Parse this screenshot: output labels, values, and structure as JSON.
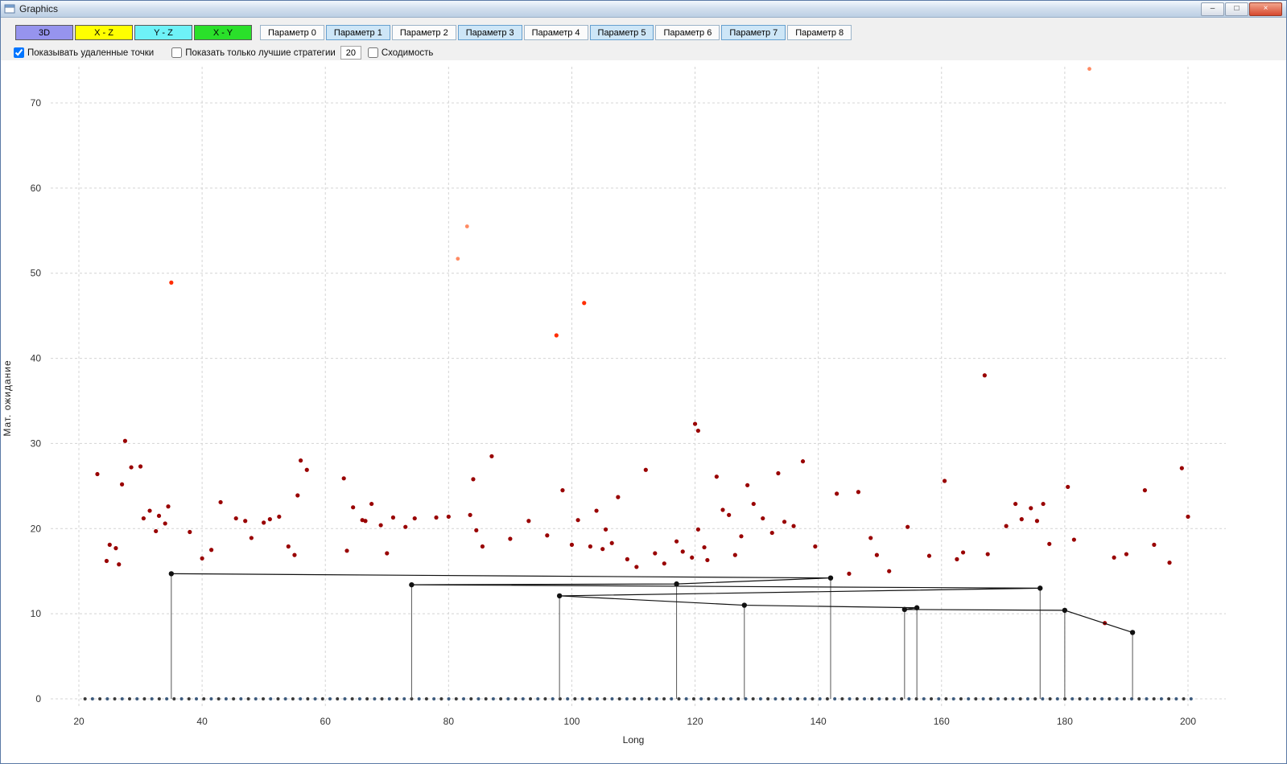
{
  "window": {
    "title": "Graphics",
    "controls": {
      "minimize": "–",
      "maximize": "□",
      "close": "×"
    }
  },
  "toolbar": {
    "view_buttons": [
      {
        "label": "3D",
        "color": "#9694ee"
      },
      {
        "label": "X - Z",
        "color": "#ffff00"
      },
      {
        "label": "Y - Z",
        "color": "#6ef2f7"
      },
      {
        "label": "X - Y",
        "color": "#2ae02a"
      }
    ],
    "param_buttons": [
      {
        "label": "Параметр 0",
        "active": false
      },
      {
        "label": "Параметр 1",
        "active": true
      },
      {
        "label": "Параметр 2",
        "active": false
      },
      {
        "label": "Параметр 3",
        "active": true
      },
      {
        "label": "Параметр 4",
        "active": false
      },
      {
        "label": "Параметр 5",
        "active": true
      },
      {
        "label": "Параметр 6",
        "active": false
      },
      {
        "label": "Параметр 7",
        "active": true
      },
      {
        "label": "Параметр 8",
        "active": false
      }
    ]
  },
  "options": {
    "show_removed_points": {
      "label": "Показывать удаленные точки",
      "checked": true
    },
    "show_best_strategies": {
      "label": "Показать только лучшие стратегии",
      "checked": false
    },
    "best_count": "20",
    "convergence": {
      "label": "Сходимость",
      "checked": false
    }
  },
  "chart_data": {
    "type": "scatter",
    "title": "",
    "xlabel": "Long",
    "ylabel": "Мат. ожидание",
    "xlim": [
      15,
      205
    ],
    "ylim": [
      -3,
      76
    ],
    "x_ticks": [
      20,
      40,
      60,
      80,
      100,
      120,
      140,
      160,
      180,
      200
    ],
    "y_ticks": [
      0,
      10,
      20,
      30,
      40,
      50,
      60,
      70
    ],
    "grid": "dashed",
    "scatter_series": [
      {
        "name": "strategies",
        "color": "#990000",
        "radius": 2.6,
        "points": [
          [
            23,
            26.4
          ],
          [
            24.5,
            16.2
          ],
          [
            25,
            18.1
          ],
          [
            26,
            17.7
          ],
          [
            26.5,
            15.8
          ],
          [
            27,
            25.2
          ],
          [
            27.5,
            30.3
          ],
          [
            28.5,
            27.2
          ],
          [
            30,
            27.3
          ],
          [
            30.5,
            21.2
          ],
          [
            31.5,
            22.1
          ],
          [
            32.5,
            19.7
          ],
          [
            33,
            21.5
          ],
          [
            34,
            20.6
          ],
          [
            34.5,
            22.6
          ],
          [
            38,
            19.6
          ],
          [
            40,
            16.5
          ],
          [
            41.5,
            17.5
          ],
          [
            43,
            23.1
          ],
          [
            45.5,
            21.2
          ],
          [
            47,
            20.9
          ],
          [
            48,
            18.9
          ],
          [
            50,
            20.7
          ],
          [
            51,
            21.1
          ],
          [
            52.5,
            21.4
          ],
          [
            54,
            17.9
          ],
          [
            55,
            16.9
          ],
          [
            55.5,
            23.9
          ],
          [
            56,
            28.0
          ],
          [
            57,
            26.9
          ],
          [
            63,
            25.9
          ],
          [
            63.5,
            17.4
          ],
          [
            64.5,
            22.5
          ],
          [
            66,
            21.0
          ],
          [
            66.5,
            20.9
          ],
          [
            67.5,
            22.9
          ],
          [
            69,
            20.4
          ],
          [
            70,
            17.1
          ],
          [
            71,
            21.3
          ],
          [
            73,
            20.2
          ],
          [
            74.5,
            21.2
          ],
          [
            78,
            21.3
          ],
          [
            80,
            21.4
          ],
          [
            83.5,
            21.6
          ],
          [
            84,
            25.8
          ],
          [
            84.5,
            19.8
          ],
          [
            85.5,
            17.9
          ],
          [
            87,
            28.5
          ],
          [
            90,
            18.8
          ],
          [
            93,
            20.9
          ],
          [
            96,
            19.2
          ],
          [
            98.5,
            24.5
          ],
          [
            100,
            18.1
          ],
          [
            101,
            21.0
          ],
          [
            103,
            17.9
          ],
          [
            104,
            22.1
          ],
          [
            105,
            17.6
          ],
          [
            105.5,
            19.9
          ],
          [
            106.5,
            18.3
          ],
          [
            107.5,
            23.7
          ],
          [
            109,
            16.4
          ],
          [
            110.5,
            15.5
          ],
          [
            112,
            26.9
          ],
          [
            113.5,
            17.1
          ],
          [
            115,
            15.9
          ],
          [
            117,
            18.5
          ],
          [
            118,
            17.3
          ],
          [
            119.5,
            16.6
          ],
          [
            120,
            32.3
          ],
          [
            120.5,
            31.5
          ],
          [
            120.5,
            19.9
          ],
          [
            121.5,
            17.8
          ],
          [
            122,
            16.3
          ],
          [
            123.5,
            26.1
          ],
          [
            124.5,
            22.2
          ],
          [
            125.5,
            21.6
          ],
          [
            126.5,
            16.9
          ],
          [
            127.5,
            19.1
          ],
          [
            128.5,
            25.1
          ],
          [
            129.5,
            22.9
          ],
          [
            131,
            21.2
          ],
          [
            132.5,
            19.5
          ],
          [
            133.5,
            26.5
          ],
          [
            134.5,
            20.8
          ],
          [
            136,
            20.3
          ],
          [
            137.5,
            27.9
          ],
          [
            139.5,
            17.9
          ],
          [
            143,
            24.1
          ],
          [
            145,
            14.7
          ],
          [
            146.5,
            24.3
          ],
          [
            148.5,
            18.9
          ],
          [
            149.5,
            16.9
          ],
          [
            151.5,
            15.0
          ],
          [
            154.5,
            20.2
          ],
          [
            158,
            16.8
          ],
          [
            160.5,
            25.6
          ],
          [
            162.5,
            16.4
          ],
          [
            163.5,
            17.2
          ],
          [
            167,
            38.0
          ],
          [
            167.5,
            17.0
          ],
          [
            170.5,
            20.3
          ],
          [
            172,
            22.9
          ],
          [
            173,
            21.1
          ],
          [
            174.5,
            22.4
          ],
          [
            175.5,
            20.9
          ],
          [
            176.5,
            22.9
          ],
          [
            177.5,
            18.2
          ],
          [
            180.5,
            24.9
          ],
          [
            181.5,
            18.7
          ],
          [
            186.5,
            8.9
          ],
          [
            188,
            16.6
          ],
          [
            190,
            17.0
          ],
          [
            193,
            24.5
          ],
          [
            194.5,
            18.1
          ],
          [
            197,
            16.0
          ],
          [
            199,
            27.1
          ],
          [
            200,
            21.4
          ]
        ]
      },
      {
        "name": "outliers-red",
        "color": "#ff2d00",
        "radius": 2.6,
        "points": [
          [
            35,
            48.9
          ],
          [
            97.5,
            42.7
          ],
          [
            102,
            46.5
          ]
        ]
      },
      {
        "name": "outliers-orange",
        "color": "#ff8a62",
        "radius": 2.4,
        "points": [
          [
            81.5,
            51.7
          ],
          [
            83,
            55.5
          ],
          [
            184,
            74.0
          ]
        ]
      }
    ],
    "baseline": {
      "y": 0,
      "x_start": 21,
      "x_end": 200.5,
      "count": 150,
      "colors": [
        "#3a3a3a",
        "#3c5a7d"
      ]
    },
    "strategy_line": {
      "name": "best-strategy-path",
      "color": "#111111",
      "drop_lines_to_zero": true,
      "points": [
        [
          35,
          14.7
        ],
        [
          142,
          14.2
        ],
        [
          117,
          13.5
        ],
        [
          74,
          13.4
        ],
        [
          176,
          13.0
        ],
        [
          98,
          12.1
        ],
        [
          128,
          11.0
        ],
        [
          156,
          10.7
        ],
        [
          154,
          10.5
        ],
        [
          180,
          10.4
        ],
        [
          191,
          7.8
        ]
      ]
    }
  }
}
